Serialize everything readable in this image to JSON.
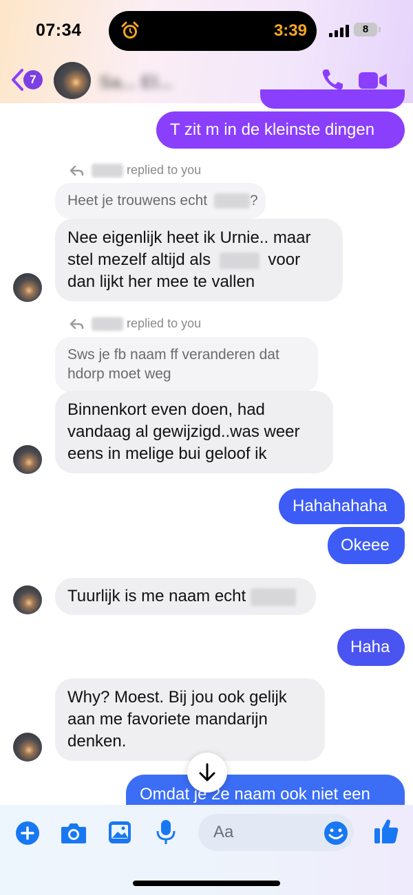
{
  "status_bar": {
    "time": "07:34",
    "timer": "3:39",
    "battery": "8"
  },
  "header": {
    "back_badge": "7",
    "contact_name": "Sa... El..."
  },
  "messages": {
    "out_top": "T zit m in de kleinste dingen",
    "reply1": {
      "label": "replied to you",
      "quote": "Heet je trouwens echt",
      "quote_end": "?"
    },
    "in1": {
      "line1": "Nee eigenlijk heet ik Urnie.. maar",
      "line2a": "stel mezelf altijd als",
      "line2b": "voor",
      "line3": "dan lijkt her mee te vallen"
    },
    "reply2": {
      "label": "replied to you",
      "quote_line1": "Sws je fb naam ff veranderen dat",
      "quote_line2": "hdorp moet weg"
    },
    "in2": {
      "line1": "Binnenkort even doen,  had",
      "line2": "vandaag al gewijzigd..was weer",
      "line3": "eens in melige bui geloof ik"
    },
    "out1": "Hahahahaha",
    "out2": "Okeee",
    "in3": "Tuurlijk is me naam echt",
    "out3": "Haha",
    "in4": {
      "line1": "Why?  Moest. Bij jou ook gelijk",
      "line2": "aan me favoriete mandarijn",
      "line3": "denken."
    },
    "out4": "Omdat je 2e naam ook niet een"
  },
  "composer": {
    "placeholder": "Aa"
  },
  "colors": {
    "purple": "#8a3ffc",
    "blue": "#3d5cf5",
    "incoming": "#efeff1",
    "icon_blue": "#1877f2"
  }
}
